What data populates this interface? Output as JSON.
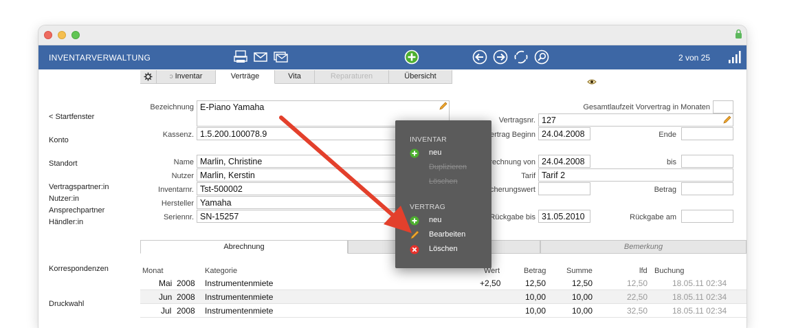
{
  "app": {
    "title": "INVENTARVERWALTUNG",
    "counter": "2 von 25"
  },
  "colors": {
    "toolbar": "#3d67a5",
    "popup": "#5b5b5b",
    "arrow": "#e3402c",
    "add_green": "#4caf2f",
    "delete_red": "#e8302a"
  },
  "toolbar_icons": [
    "printer-icon",
    "mail-icon",
    "mail-stack-icon",
    "add-record-icon",
    "previous-icon",
    "next-icon",
    "refresh-icon",
    "search-icon",
    "signal-bars-icon"
  ],
  "sidebar": {
    "items": [
      "< Startfenster",
      "Konto",
      "Standort",
      "Vertragspartner:in",
      "Nutzer:in",
      "Ansprechpartner",
      "Händler:in",
      "Korrespondenzen",
      "Druckwahl"
    ]
  },
  "tabs": [
    "Inventar",
    "Verträge",
    "Vita",
    "Reparaturen",
    "Übersicht"
  ],
  "form": {
    "bezeichnung_label": "Bezeichnung",
    "bezeichnung": "E-Piano Yamaha",
    "kassenz_label": "Kassenz.",
    "kassenz": "1.5.200.100078.9",
    "name_label": "Name",
    "name": "Marlin, Christine",
    "nutzer_label": "Nutzer",
    "nutzer": "Marlin, Kerstin",
    "inventarnr_label": "Inventarnr.",
    "inventarnr": "Tst-500002",
    "hersteller_label": "Hersteller",
    "hersteller": "Yamaha",
    "seriennr_label": "Seriennr.",
    "seriennr": "SN-15257",
    "gesamtlaufzeit_label": "Gesamtlaufzeit Vorvertrag in Monaten",
    "vertragsnr_label": "Vertragsnr.",
    "vertragsnr": "127",
    "vertrag_beginn_label": "Vertrag Beginn",
    "vertrag_beginn": "24.04.2008",
    "ende_label": "Ende",
    "abrechnung_von_label": "Abrechnung von",
    "abrechnung_von": "24.04.2008",
    "bis_label": "bis",
    "tarif_label": "Tarif",
    "tarif": "Tarif 2",
    "versicherungswert_label": "Versicherungswert",
    "betrag_label": "Betrag",
    "rueckgabe_bis_label": "Rückgabe bis",
    "rueckgabe_bis": "31.05.2010",
    "rueckgabe_am_label": "Rückgabe am"
  },
  "subtabs": [
    "Abrechnung",
    "",
    "Bemerkung"
  ],
  "table": {
    "headers": [
      "Monat",
      "Kategorie",
      "Wert",
      "Betrag",
      "Summe",
      "lfd",
      "Buchung"
    ],
    "rows": [
      {
        "month": "Mai",
        "year": "2008",
        "kategorie": "Instrumentenmiete",
        "wert": "+2,50",
        "betrag": "12,50",
        "summe": "12,50",
        "lfd": "12,50",
        "buchung": "18.05.11 02:34"
      },
      {
        "month": "Jun",
        "year": "2008",
        "kategorie": "Instrumentenmiete",
        "wert": "",
        "betrag": "10,00",
        "summe": "10,00",
        "lfd": "22,50",
        "buchung": "18.05.11 02:34"
      },
      {
        "month": "Jul",
        "year": "2008",
        "kategorie": "Instrumentenmiete",
        "wert": "",
        "betrag": "10,00",
        "summe": "10,00",
        "lfd": "32,50",
        "buchung": "18.05.11 02:34"
      }
    ]
  },
  "popup": {
    "inventar_head": "INVENTAR",
    "inventar_new": "neu",
    "inventar_dup": "Duplizieren",
    "inventar_del": "Löschen",
    "vertrag_head": "VERTRAG",
    "vertrag_new": "neu",
    "vertrag_edit": "Bearbeiten",
    "vertrag_del": "Löschen"
  }
}
